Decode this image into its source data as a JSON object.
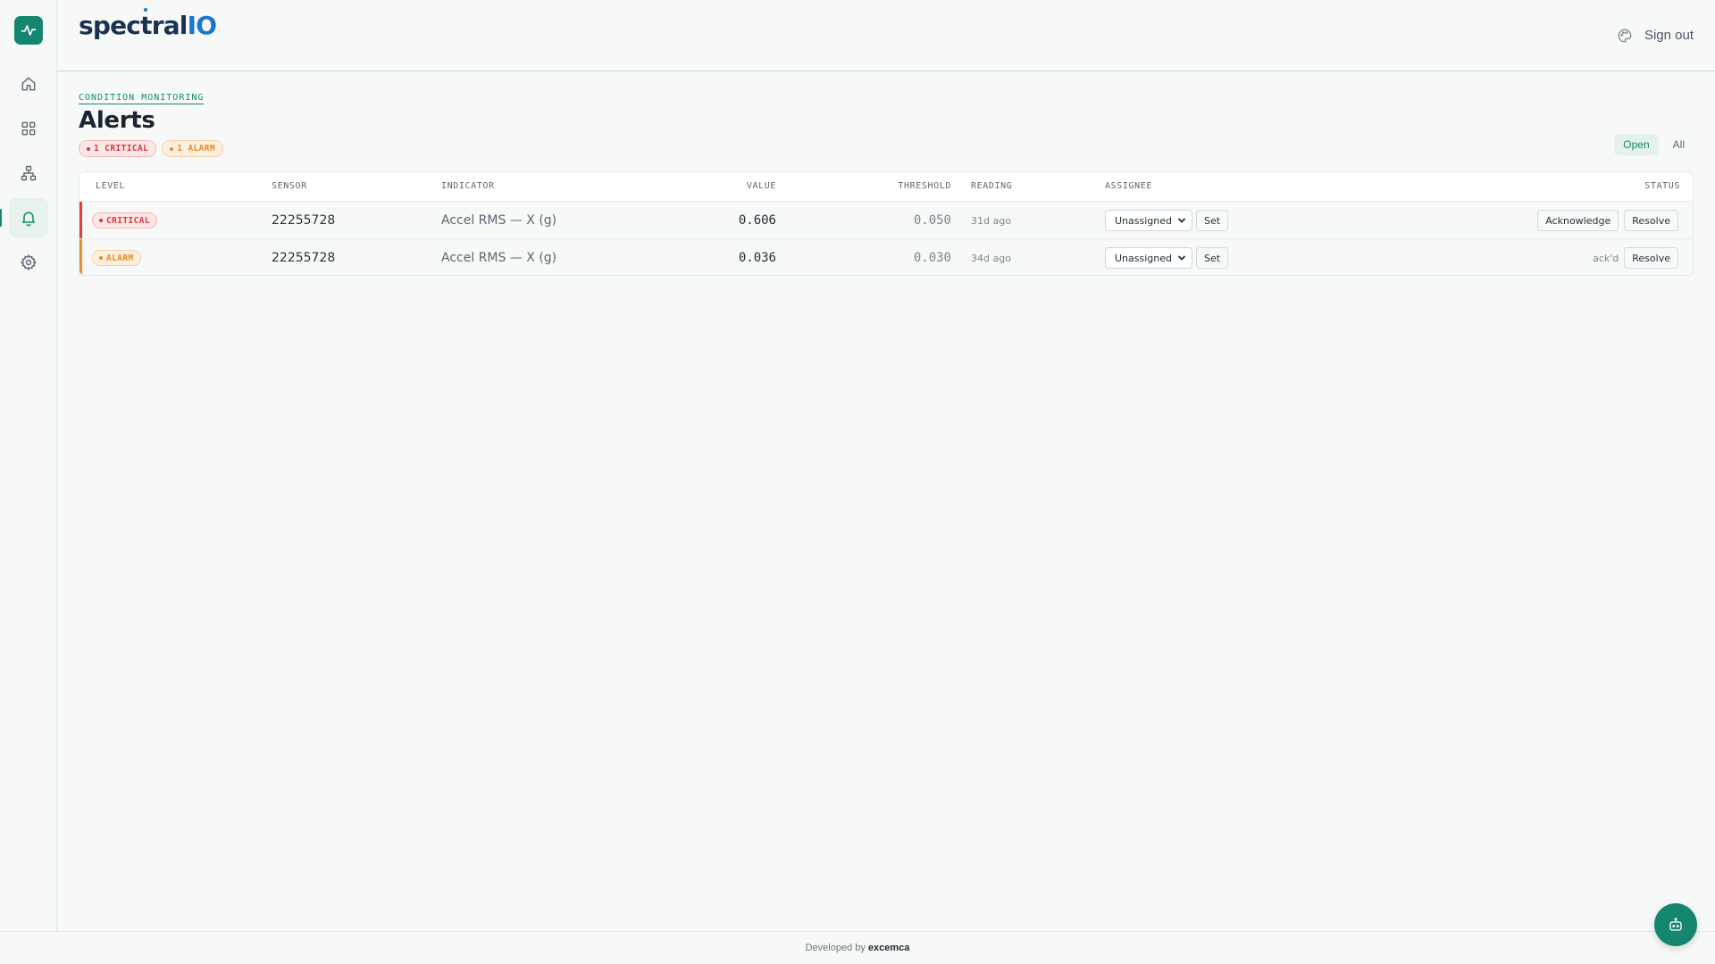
{
  "brand": {
    "name_main": "spec",
    "name_t": "t",
    "name_tail": "ral",
    "name_io": "IO"
  },
  "header": {
    "sign_out": "Sign out"
  },
  "sidebar": {
    "items": [
      {
        "name": "home",
        "icon": "home-icon",
        "active": false
      },
      {
        "name": "dashboards",
        "icon": "grid-icon",
        "active": false
      },
      {
        "name": "hierarchy",
        "icon": "hierarchy-icon",
        "active": false
      },
      {
        "name": "alerts",
        "icon": "bell-icon",
        "active": true
      },
      {
        "name": "settings",
        "icon": "gear-icon",
        "active": false
      }
    ]
  },
  "page": {
    "eyebrow": "CONDITION MONITORING",
    "title": "Alerts",
    "summary": {
      "critical": "1 CRITICAL",
      "alarm": "1 ALARM"
    },
    "filters": {
      "open": "Open",
      "all": "All",
      "selected": "Open"
    }
  },
  "table": {
    "headers": {
      "level": "LEVEL",
      "sensor": "SENSOR",
      "indicator": "INDICATOR",
      "value": "VALUE",
      "threshold": "THRESHOLD",
      "reading": "READING",
      "assignee": "ASSIGNEE",
      "status": "STATUS"
    },
    "rows": [
      {
        "level": "CRITICAL",
        "sensor": "22255728",
        "indicator": "Accel RMS — X (g)",
        "value": "0.606",
        "threshold": "0.050",
        "reading": "31d ago",
        "assignee": "Unassigned",
        "set": "Set",
        "acknowledge": "Acknowledge",
        "resolve": "Resolve"
      },
      {
        "level": "ALARM",
        "sensor": "22255728",
        "indicator": "Accel RMS — X (g)",
        "value": "0.036",
        "threshold": "0.030",
        "reading": "34d ago",
        "assignee": "Unassigned",
        "set": "Set",
        "status_note": "ack'd",
        "resolve": "Resolve"
      }
    ]
  },
  "footer": {
    "prefix": "Developed by",
    "author": "excemca"
  },
  "colors": {
    "accent": "#15866f",
    "critical": "#d83a3a",
    "alarm": "#e68a25",
    "brand_io": "#1b78c8"
  }
}
